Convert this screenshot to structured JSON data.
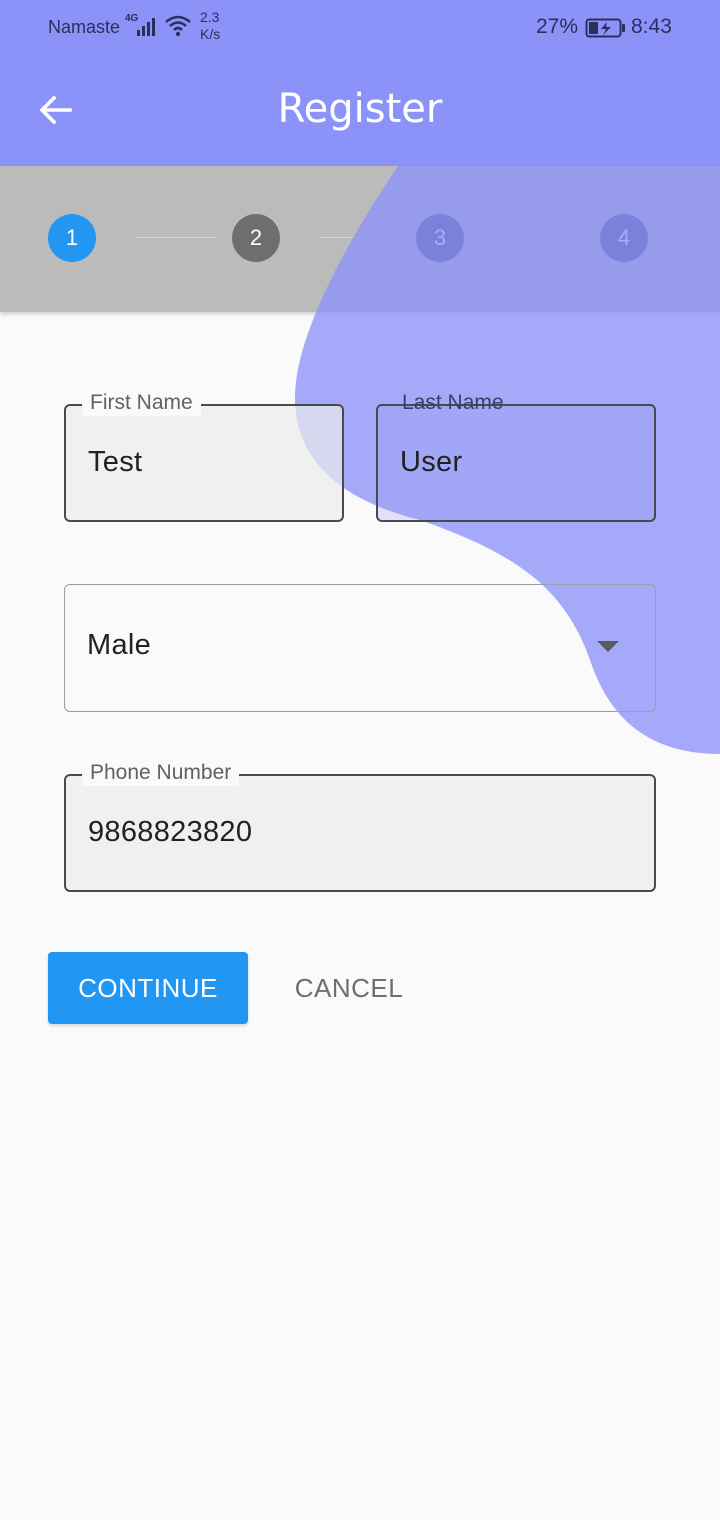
{
  "status_bar": {
    "carrier": "Namaste",
    "network": "4G",
    "speed_value": "2.3",
    "speed_unit": "K/s",
    "battery": "27%",
    "time": "8:43"
  },
  "app_bar": {
    "title": "Register",
    "back_icon": "arrow-left-icon"
  },
  "stepper": {
    "active_step": 1,
    "steps": [
      "1",
      "2",
      "3",
      "4"
    ]
  },
  "form": {
    "first_name": {
      "label": "First Name",
      "value": "Test"
    },
    "last_name": {
      "label": "Last Name",
      "value": "User"
    },
    "gender": {
      "value": "Male",
      "icon": "dropdown-arrow-icon"
    },
    "phone": {
      "label": "Phone Number",
      "value": "9868823820"
    }
  },
  "actions": {
    "continue": "CONTINUE",
    "cancel": "CANCEL"
  },
  "colors": {
    "app_bar": "#8c93f8",
    "accent": "#2196f3",
    "blob": "#9399f8"
  }
}
